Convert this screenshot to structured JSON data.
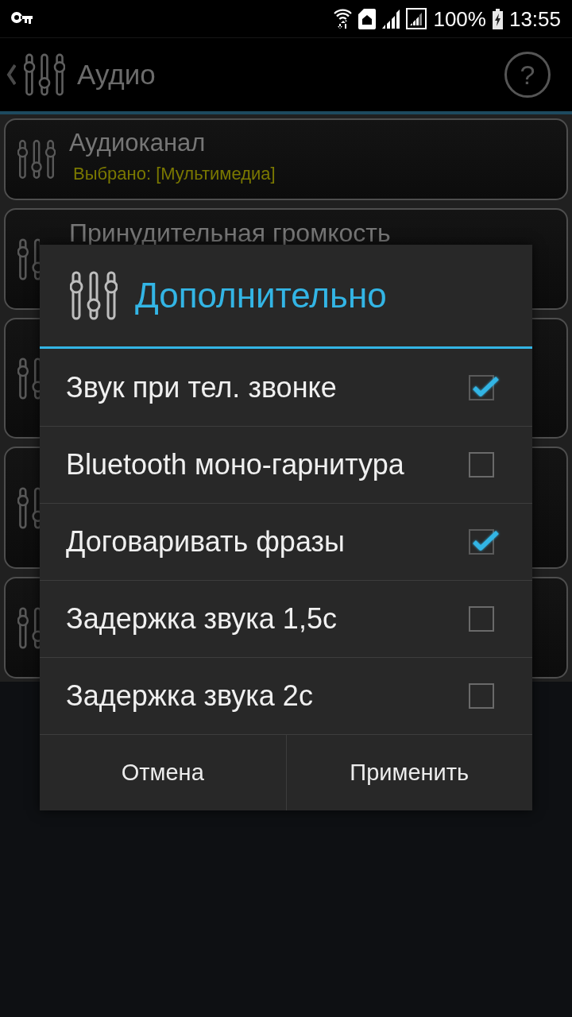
{
  "status_bar": {
    "battery": "100%",
    "time": "13:55"
  },
  "action_bar": {
    "title": "Аудио",
    "help": "?"
  },
  "settings": [
    {
      "kind": "visible",
      "title": "Аудиоканал",
      "subtitle": "Выбрано: [Мультимедиа]"
    },
    {
      "kind": "covered",
      "title": "Принудительная громкость"
    },
    {
      "kind": "covered"
    },
    {
      "kind": "covered"
    },
    {
      "kind": "covered"
    }
  ],
  "dialog": {
    "title": "Дополнительно",
    "options": [
      {
        "label": "Звук при тел. звонке",
        "checked": true
      },
      {
        "label": "Bluetooth моно-гарнитура",
        "checked": false
      },
      {
        "label": "Договаривать фразы",
        "checked": true
      },
      {
        "label": "Задержка звука 1,5с",
        "checked": false
      },
      {
        "label": "Задержка звука 2с",
        "checked": false
      }
    ],
    "buttons": [
      "Отмена",
      "Применить"
    ]
  }
}
